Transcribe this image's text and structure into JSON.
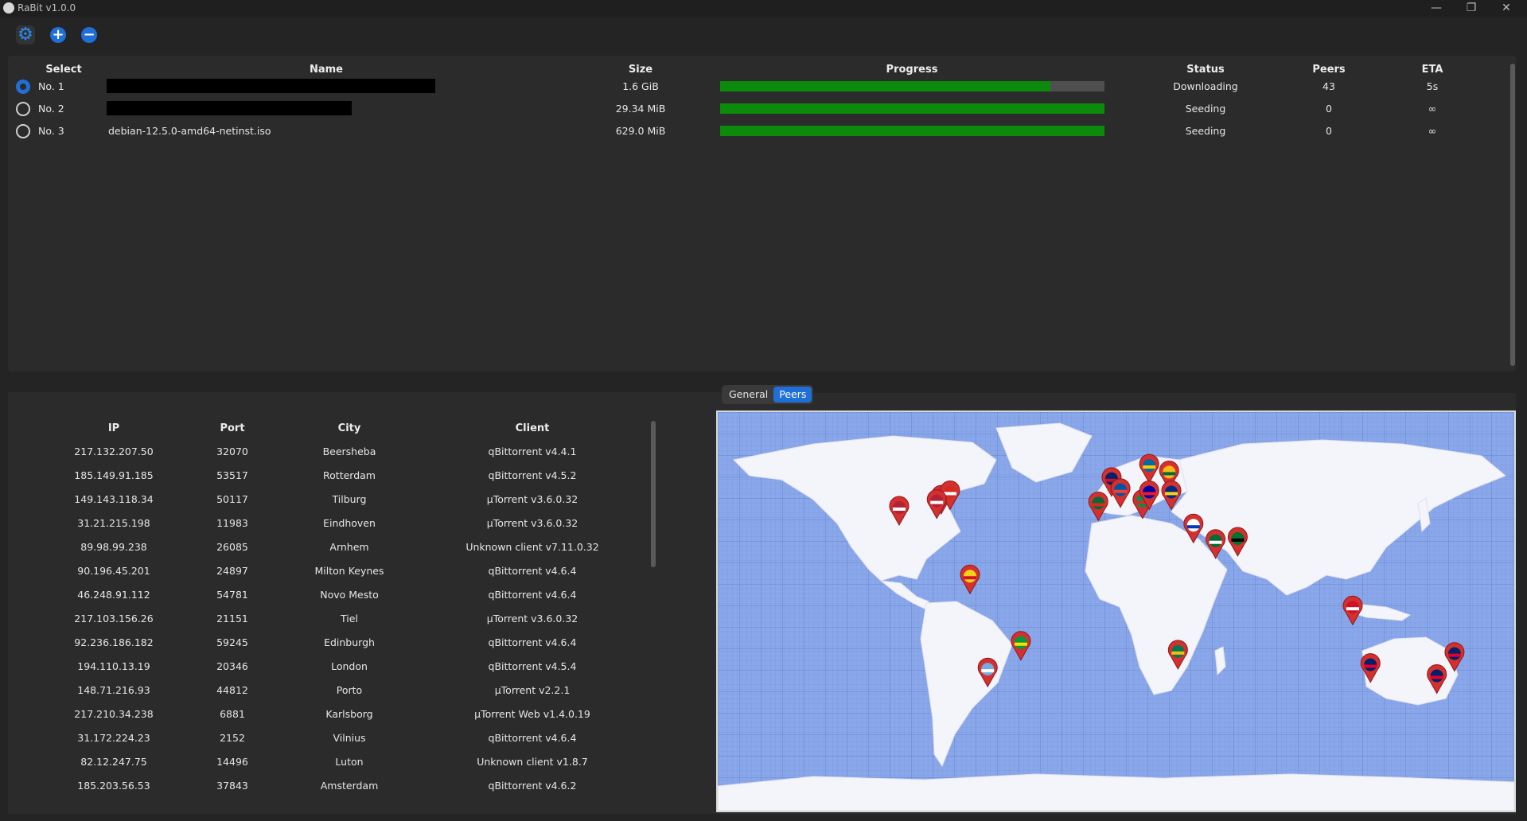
{
  "window": {
    "title": "RaBit v1.0.0",
    "min": "—",
    "restore": "❐",
    "close": "✕"
  },
  "toolbar": {
    "settings_icon": "gear-icon",
    "add_icon": "plus-icon",
    "remove_icon": "minus-icon",
    "add_label": "+",
    "remove_label": "−"
  },
  "torrents": {
    "headers": {
      "select": "Select",
      "name": "Name",
      "size": "Size",
      "progress": "Progress",
      "status": "Status",
      "peers": "Peers",
      "eta": "ETA"
    },
    "rows": [
      {
        "select": "No. 1",
        "name": "",
        "redacted": true,
        "size": "1.6 GiB",
        "progress": 0.86,
        "status": "Downloading",
        "peers": "43",
        "eta": "5s",
        "selected": true
      },
      {
        "select": "No. 2",
        "name": "",
        "redacted": true,
        "size": "29.34 MiB",
        "progress": 1.0,
        "status": "Seeding",
        "peers": "0",
        "eta": "∞",
        "selected": false
      },
      {
        "select": "No. 3",
        "name": "debian-12.5.0-amd64-netinst.iso",
        "redacted": false,
        "size": "629.0 MiB",
        "progress": 1.0,
        "status": "Seeding",
        "peers": "0",
        "eta": "∞",
        "selected": false
      }
    ]
  },
  "tabs": [
    {
      "label": "General",
      "selected": false
    },
    {
      "label": "Peers",
      "selected": true
    }
  ],
  "peers": {
    "headers": {
      "ip": "IP",
      "port": "Port",
      "city": "City",
      "client": "Client"
    },
    "rows": [
      {
        "ip": "217.132.207.50",
        "port": "32070",
        "city": "Beersheba",
        "client": "qBittorrent v4.4.1"
      },
      {
        "ip": "185.149.91.185",
        "port": "53517",
        "city": "Rotterdam",
        "client": "qBittorrent v4.5.2"
      },
      {
        "ip": "149.143.118.34",
        "port": "50117",
        "city": "Tilburg",
        "client": "µTorrent v3.6.0.32"
      },
      {
        "ip": "31.21.215.198",
        "port": "11983",
        "city": "Eindhoven",
        "client": "µTorrent v3.6.0.32"
      },
      {
        "ip": "89.98.99.238",
        "port": "26085",
        "city": "Arnhem",
        "client": "Unknown client v7.11.0.32"
      },
      {
        "ip": "90.196.45.201",
        "port": "24897",
        "city": "Milton Keynes",
        "client": "qBittorrent v4.6.4"
      },
      {
        "ip": "46.248.91.112",
        "port": "54781",
        "city": "Novo Mesto",
        "client": "qBittorrent v4.6.4"
      },
      {
        "ip": "217.103.156.26",
        "port": "21151",
        "city": "Tiel",
        "client": "µTorrent v3.6.0.32"
      },
      {
        "ip": "92.236.186.182",
        "port": "59245",
        "city": "Edinburgh",
        "client": "qBittorrent v4.6.4"
      },
      {
        "ip": "194.110.13.19",
        "port": "20346",
        "city": "London",
        "client": "qBittorrent v4.5.4"
      },
      {
        "ip": "148.71.216.93",
        "port": "44812",
        "city": "Porto",
        "client": "µTorrent v2.2.1"
      },
      {
        "ip": "217.210.34.238",
        "port": "6881",
        "city": "Karlsborg",
        "client": "µTorrent Web v1.4.0.19"
      },
      {
        "ip": "31.172.224.23",
        "port": "2152",
        "city": "Vilnius",
        "client": "qBittorrent v4.6.4"
      },
      {
        "ip": "82.12.247.75",
        "port": "14496",
        "city": "Luton",
        "client": "Unknown client v1.8.7"
      },
      {
        "ip": "185.203.56.53",
        "port": "37843",
        "city": "Amsterdam",
        "client": "qBittorrent v4.6.2"
      }
    ]
  },
  "colors": {
    "accent": "#1f6fd6",
    "progress": "#0b8a0b",
    "ocean": "#7f9fe6",
    "land": "#f4f4fb",
    "marker": "#d43030"
  },
  "map": {
    "markers": [
      {
        "country": "US",
        "lon": -98,
        "lat": 39
      },
      {
        "country": "CA",
        "lon": -79,
        "lat": 44
      },
      {
        "country": "CA",
        "lon": -75,
        "lat": 46
      },
      {
        "country": "US",
        "lon": -81,
        "lat": 42
      },
      {
        "country": "VE",
        "lon": -66,
        "lat": 8
      },
      {
        "country": "BR",
        "lon": -43,
        "lat": -22
      },
      {
        "country": "AR",
        "lon": -58,
        "lat": -34
      },
      {
        "country": "GB",
        "lon": -2,
        "lat": 52
      },
      {
        "country": "FR",
        "lon": 2,
        "lat": 47
      },
      {
        "country": "IT",
        "lon": 12,
        "lat": 42
      },
      {
        "country": "PT",
        "lon": -8,
        "lat": 41
      },
      {
        "country": "SE",
        "lon": 15,
        "lat": 58
      },
      {
        "country": "LT",
        "lon": 24,
        "lat": 55
      },
      {
        "country": "SI",
        "lon": 15,
        "lat": 46
      },
      {
        "country": "RO",
        "lon": 25,
        "lat": 46
      },
      {
        "country": "IL",
        "lon": 35,
        "lat": 31
      },
      {
        "country": "SA",
        "lon": 45,
        "lat": 24
      },
      {
        "country": "AE",
        "lon": 55,
        "lat": 25
      },
      {
        "country": "ZA",
        "lon": 28,
        "lat": -26
      },
      {
        "country": "ID",
        "lon": 107,
        "lat": -6
      },
      {
        "country": "AU",
        "lon": 115,
        "lat": -32
      },
      {
        "country": "AU",
        "lon": 145,
        "lat": -37
      },
      {
        "country": "AU",
        "lon": 153,
        "lat": -27
      }
    ]
  }
}
